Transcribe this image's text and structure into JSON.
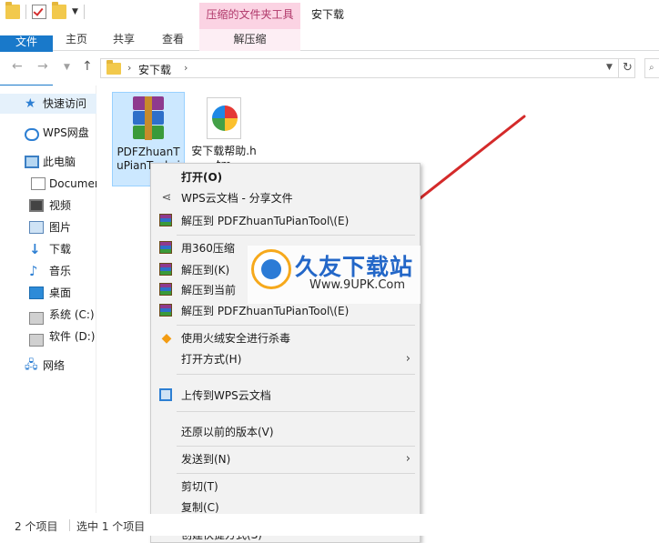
{
  "titlebar": {
    "context_tab_group": "压缩的文件夹工具",
    "window_title": "安下载"
  },
  "ribbon": {
    "tabs": [
      "文件",
      "主页",
      "共享",
      "查看",
      "解压缩"
    ]
  },
  "address": {
    "breadcrumb": "安下载",
    "refresh_glyph": "↻"
  },
  "sidebar": {
    "items": [
      {
        "label": "快速访问",
        "icon": "star-icon"
      },
      {
        "label": "WPS网盘",
        "icon": "cloud-icon"
      },
      {
        "label": "此电脑",
        "icon": "computer-icon"
      },
      {
        "label": "Documer",
        "icon": "document-icon"
      },
      {
        "label": "视频",
        "icon": "video-icon"
      },
      {
        "label": "图片",
        "icon": "picture-icon"
      },
      {
        "label": "下载",
        "icon": "download-icon"
      },
      {
        "label": "音乐",
        "icon": "music-icon"
      },
      {
        "label": "桌面",
        "icon": "desktop-icon"
      },
      {
        "label": "系统 (C:)",
        "icon": "drive-icon"
      },
      {
        "label": "软件 (D:)",
        "icon": "drive-icon"
      },
      {
        "label": "网络",
        "icon": "network-icon"
      }
    ]
  },
  "files": [
    {
      "name": "PDFZhuanTuPianTool.zi",
      "icon": "winrar-archive-icon",
      "selected": true
    },
    {
      "name": "安下载帮助.htm",
      "icon": "html-file-icon",
      "selected": false
    }
  ],
  "context_menu": {
    "items": [
      {
        "label": "打开(O)",
        "bold": true
      },
      {
        "label": "WPS云文档 - 分享文件",
        "icon": "share-icon"
      },
      {
        "label": "解压到 PDFZhuanTuPianTool\\(E)",
        "icon": "winrar-icon"
      },
      {
        "label": "用360压缩",
        "icon": "winrar-icon"
      },
      {
        "label": "解压到(K)",
        "icon": "winrar-icon"
      },
      {
        "label": "解压到当前",
        "icon": "winrar-icon"
      },
      {
        "label": "解压到 PDFZhuanTuPianTool\\(E)",
        "icon": "winrar-icon"
      },
      {
        "label": "使用火绒安全进行杀毒",
        "icon": "shield-icon"
      },
      {
        "label": "打开方式(H)",
        "submenu": true
      },
      {
        "label": "上传到WPS云文档",
        "icon": "cube-icon"
      },
      {
        "label": "还原以前的版本(V)"
      },
      {
        "label": "发送到(N)",
        "submenu": true
      },
      {
        "label": "剪切(T)"
      },
      {
        "label": "复制(C)"
      },
      {
        "label": "创建快捷方式(S)"
      }
    ]
  },
  "watermark": {
    "title": "久友下载站",
    "url": "Www.9UPK.Com"
  },
  "statusbar": {
    "item_count": "2 个项目",
    "selected_count": "选中 1 个项目"
  },
  "colors": {
    "file_tab": "#1979ca",
    "context_tab": "#fbd3e3",
    "selection": "#cce8ff",
    "arrow": "#d42a2a"
  }
}
